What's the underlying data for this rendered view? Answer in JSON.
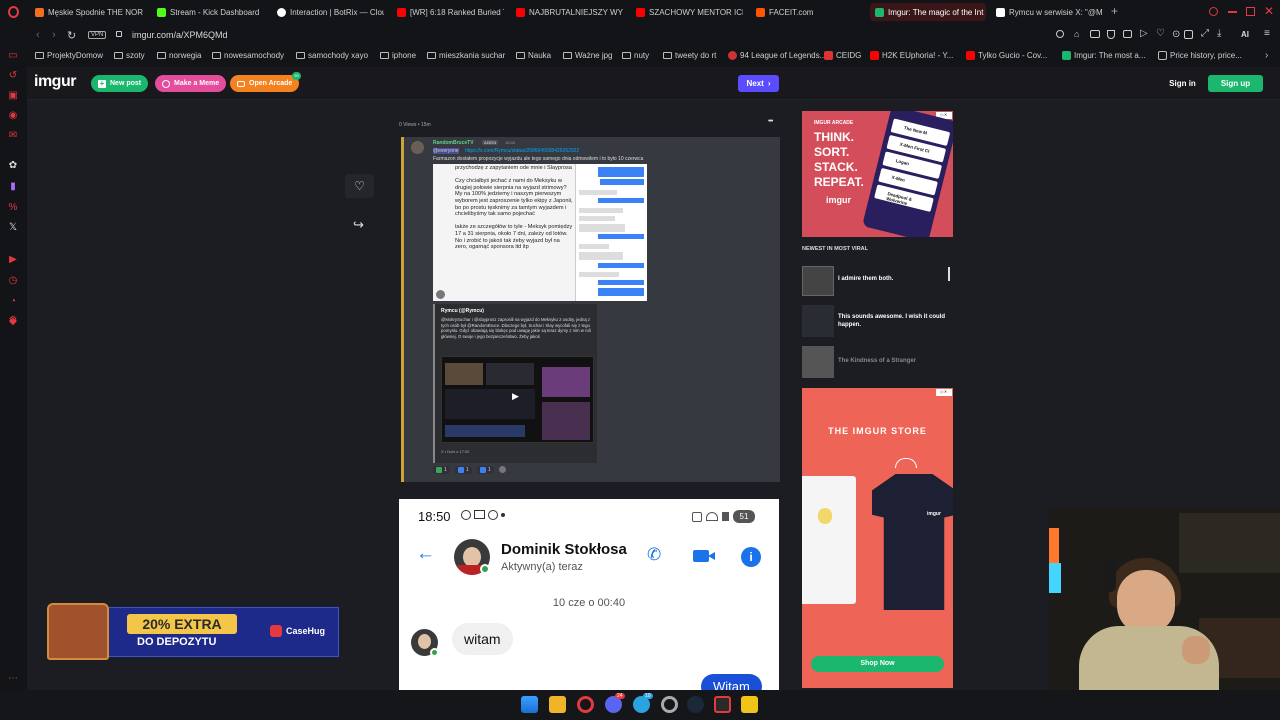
{
  "browser": {
    "tabs": [
      {
        "title": "Męskie Spodnie THE NOR",
        "color": "#f07020",
        "active": false
      },
      {
        "title": "Stream - Kick Dashboard",
        "color": "#53fc18",
        "active": false
      },
      {
        "title": "Interaction | BotRix — Clou",
        "color": "#ffffff",
        "active": false
      },
      {
        "title": "[WR] 6:18 Ranked Buried T",
        "color": "#ff0000",
        "active": false
      },
      {
        "title": "NAJBRUTALNIEJSZY WYS",
        "color": "#ff0000",
        "active": false
      },
      {
        "title": "SZACHOWY MENTOR ICE",
        "color": "#ff0000",
        "active": false
      },
      {
        "title": "FACEIT.com",
        "color": "#ff5500",
        "active": false
      },
      {
        "title": "Imgur: The magic of the Int",
        "color": "#1bb76e",
        "active": true
      },
      {
        "title": "Rymcu w serwisie X: \"@M",
        "color": "#ffffff",
        "active": false
      }
    ],
    "new_tab_symbol": "+",
    "vpn_label": "VPN",
    "url": "imgur.com/a/XPM6QMd",
    "ai_label": "AI",
    "bookmarks": [
      "ProjektyDomow",
      "szoty",
      "norwegia",
      "nowesamochody",
      "samochody xayo",
      "iphone",
      "mieszkania suchar",
      "Nauka",
      "Ważne jpg",
      "nuty",
      "tweety do rt",
      "94 League of Legends...",
      "CEIDG",
      "H2K EUphoria! - Y...",
      "Tylko Gucio - Cov...",
      "Imgur: The most a...",
      "Price history, price..."
    ]
  },
  "imgur": {
    "logo": "imgur",
    "new_post": "New post",
    "make_meme": "Make a Meme",
    "open_arcade": "Open Arcade",
    "arcade_badge": "99",
    "next": "Next",
    "sign_in": "Sign in",
    "sign_up": "Sign up",
    "meta": "0 Views • 15m",
    "more_menu": "•••"
  },
  "post1": {
    "discord_username": "RandomBruceTV",
    "discord_role": "ADEIN",
    "discord_time": "15:45",
    "mention": "@everyone",
    "link": "https://x.com/Rymcu/status/2086645008426262922",
    "message": "Farmazon dostałem propozycje wyjazdu ale tego samego dnia odmowilem i to było 10 czerwca",
    "chat_left": "przychodzę z zapytaniem ode mnie i Slayprosa\n\nCzy chciałbyś jechać z nami do Meksyku w drugiej połowie sierpnia na wyjazd strimowy? My na 100% jedziemy i naszym pierwszym wyborem jest zaproszenie tylko ekipy z Japonii, bo po prostu tęsknimy za tamtym wyjazdem i chcielibyśmy tak samo pojechać\n\ntakże ze szczegółów to tyle - Meksyk pomiędzy 17 a 31 sierpnia, około 7 dni, zależy od lotów. No i zrobić to jakoś tak żeby wyjazd był na zero, ogarnąć sponsora itd itp",
    "embed_author": "Rymcu (@Rymcu)",
    "embed_text": "@MokrySuchar i @slayprosz zaprosili na wyjazd do Meksyku 2 osoby, jedną z tych osób był @RandomBruce. Dlaczego był, Suchar i Slay wycofali się z tego pomysłu. Gdyż obawiają się blokęc pod uwagę jakie są teraz dymy z nim w roli głównej. O swoje i jego bezpieczeństwo. Żeby jakoś",
    "embed_footer": "X • Dziś o 17:52",
    "reactions": [
      "1",
      "1",
      "1"
    ]
  },
  "post2": {
    "time": "18:50",
    "battery": "51",
    "contact_name": "Dominik Stokłosa",
    "contact_status": "Aktywny(a) teraz",
    "date_sep": "10 cze o 00:40",
    "msg_in": "witam",
    "msg_out": "Witam"
  },
  "right": {
    "arcade_ad_label": "IMGUR ARCADE",
    "arcade_lines": [
      "THINK.",
      "SORT.",
      "STACK.",
      "REPEAT."
    ],
    "arcade_brand": "imgur",
    "phone_cards": [
      "The New M",
      "X-Men First Cl",
      "Logan",
      "X-Men",
      "Deadpool & Wolverine"
    ],
    "viral_heading": "NEWEST IN MOST VIRAL",
    "viral": [
      {
        "title": "I admire them both."
      },
      {
        "title": "This sounds awesome. I wish it could happen."
      },
      {
        "title": "The Kindness of a Stranger"
      }
    ],
    "store_title": "THE IMGUR STORE",
    "shirt_logo": "imgur",
    "shop_now": "Shop Now"
  },
  "promo": {
    "extra": "20% EXTRA",
    "deposit": "DO DEPOZYTU",
    "brand": "CaseHug"
  },
  "taskbar": {
    "discord_badge": "24",
    "telegram_badge": "10"
  }
}
